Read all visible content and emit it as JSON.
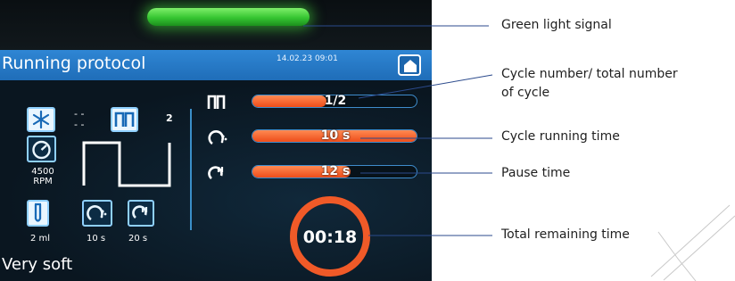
{
  "screen": {
    "header_title": "Running protocol",
    "datetime": "14.02.23 09:01",
    "home_icon": "home-icon",
    "status_light_color": "#35c531",
    "accent_color": "#2f86d4",
    "bar_color": "#ee4d1a"
  },
  "left_panel": {
    "mode_badge": "2",
    "speed_value": "4500",
    "speed_unit": "RPM",
    "volume": "2 ml",
    "cycle_time": "10 s",
    "pause_time": "20 s",
    "profile_name": "Very soft"
  },
  "bars": [
    {
      "icon": "pulse-icon",
      "value": "1/2",
      "fill": 0.45
    },
    {
      "icon": "cycle-time-icon",
      "value": "10 s",
      "fill": 1.0
    },
    {
      "icon": "pause-time-icon",
      "value": "12 s",
      "fill": 0.6
    }
  ],
  "timer": {
    "value": "00:18",
    "progress": 1.0
  },
  "annotations": {
    "green_light": "Green light signal",
    "cycle_number_line1": "Cycle number/ total number",
    "cycle_number_line2": "of cycle",
    "cycle_running_time": "Cycle running time",
    "pause_time": "Pause time",
    "total_remaining_time": "Total remaining time"
  }
}
